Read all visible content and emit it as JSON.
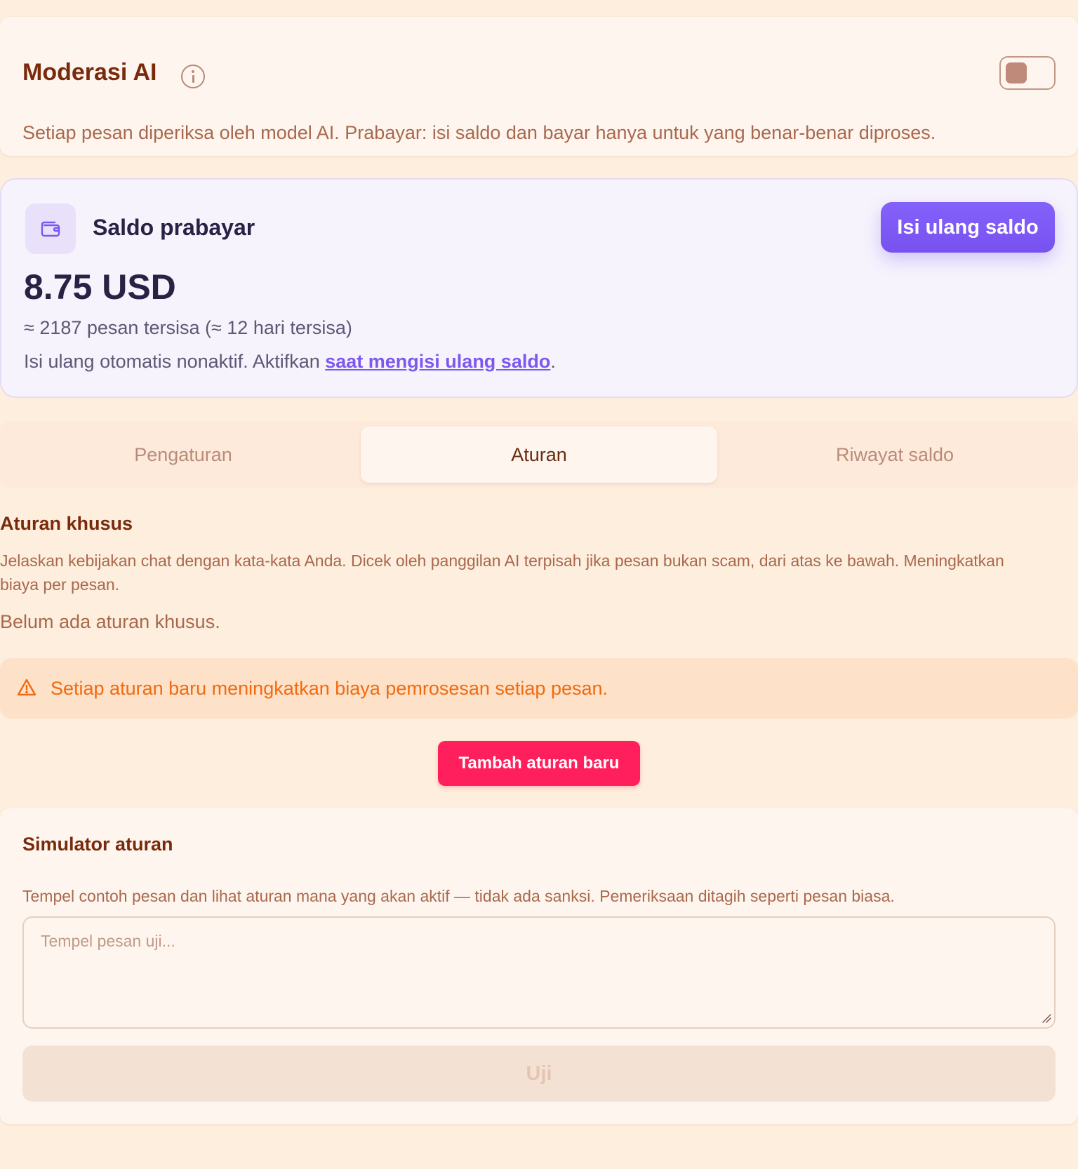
{
  "header": {
    "title": "Moderasi AI",
    "description": "Setiap pesan diperiksa oleh model AI. Prabayar: isi saldo dan bayar hanya untuk yang benar-benar diproses.",
    "toggle_enabled": false
  },
  "balance": {
    "label": "Saldo prabayar",
    "amount": "8.75 USD",
    "estimate": "≈ 2187 pesan tersisa (≈ 12 hari tersisa)",
    "auto_topup_prefix": "Isi ulang otomatis nonaktif. Aktifkan ",
    "auto_topup_link": "saat mengisi ulang saldo",
    "auto_topup_suffix": ".",
    "topup_button": "Isi ulang saldo"
  },
  "tabs": [
    {
      "label": "Pengaturan",
      "active": false
    },
    {
      "label": "Aturan",
      "active": true
    },
    {
      "label": "Riwayat saldo",
      "active": false
    }
  ],
  "rules": {
    "title": "Aturan khusus",
    "description": "Jelaskan kebijakan chat dengan kata-kata Anda. Dicek oleh panggilan AI terpisah jika pesan bukan scam, dari atas ke bawah. Meningkatkan biaya per pesan.",
    "empty_text": "Belum ada aturan khusus.",
    "warning": "Setiap aturan baru meningkatkan biaya pemrosesan setiap pesan.",
    "add_button": "Tambah aturan baru"
  },
  "simulator": {
    "title": "Simulator aturan",
    "description": "Tempel contoh pesan dan lihat aturan mana yang akan aktif — tidak ada sanksi. Pemeriksaan ditagih seperti pesan biasa.",
    "input_value": "",
    "input_placeholder": "Tempel pesan uji...",
    "test_button": "Uji"
  },
  "colors": {
    "page_background": "#fdeedd",
    "heading": "#7a2a0c",
    "accent_purple": "#7752f0",
    "accent_pink": "#ff1f5c",
    "warning": "#f26a0d"
  },
  "icons": {
    "info": "info-icon",
    "wallet": "wallet-icon",
    "warning": "warning-triangle-icon",
    "resize": "resize-grip-icon"
  }
}
